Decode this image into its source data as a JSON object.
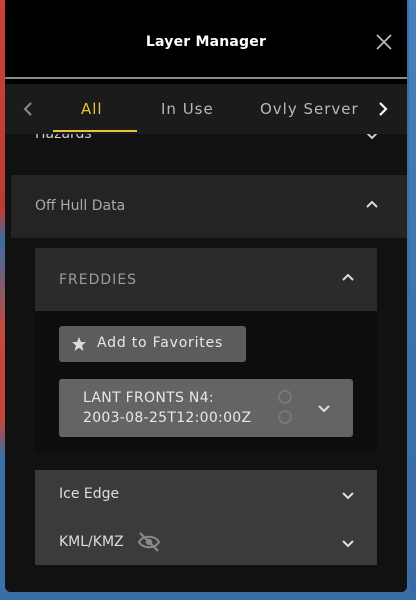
{
  "window": {
    "title": "Layer Manager"
  },
  "tabs": [
    {
      "label": "All",
      "active": true
    },
    {
      "label": "In Use",
      "active": false
    },
    {
      "label": "Ovly Server",
      "active": false
    }
  ],
  "sections": {
    "hazards": {
      "label": "Hazards",
      "state": "collapsed"
    },
    "off_hull": {
      "label": "Off Hull Data",
      "state": "expanded"
    },
    "freddies": {
      "label": "FREDDIES",
      "state": "expanded",
      "favorites_button": "Add to Favorites",
      "layer": {
        "line1": "LANT FRONTS N4:",
        "line2": "2003-08-25T12:00:00Z"
      }
    },
    "ice_edge": {
      "label": "Ice Edge",
      "state": "collapsed"
    },
    "kml": {
      "label": "KML/KMZ",
      "state": "collapsed"
    }
  },
  "colors": {
    "accent": "#e8c43a",
    "panel": "#000000",
    "text": "#cfcfcf"
  },
  "icons": {
    "close": "close-icon",
    "prev": "chevron-left-icon",
    "next": "chevron-right-icon",
    "star": "star-icon",
    "hidden": "eye-off-icon"
  }
}
